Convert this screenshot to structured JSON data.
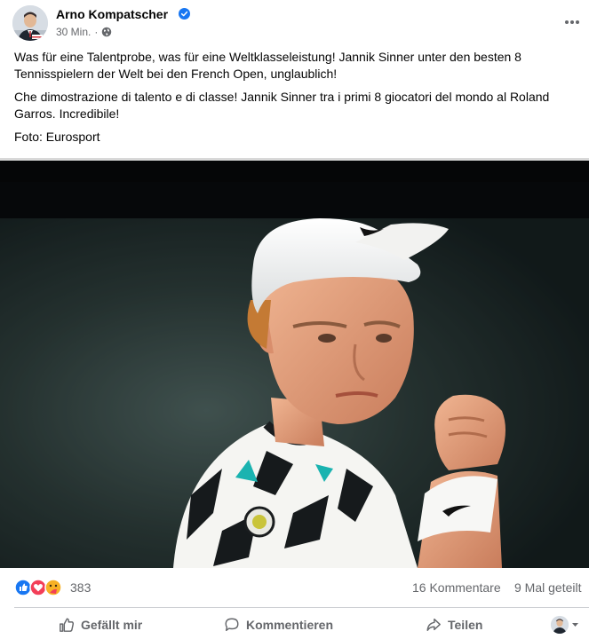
{
  "post": {
    "author": "Arno Kompatscher",
    "timestamp": "30 Min.",
    "separator": "·",
    "privacy_icon": "globe-icon",
    "verified_icon": "verified-badge-icon",
    "more_icon": "more-options-icon",
    "text_de": "Was für eine Talentprobe, was für eine Weltklasseleistung! Jannik Sinner unter den besten 8 Tennisspielern der Welt bei den French Open, unglaublich!",
    "text_it": "Che dimostrazione di talento e di classe! Jannik Sinner tra i primi 8 giocatori del mondo al Roland Garros. Incredibile!",
    "text_credit": "Foto: Eurosport"
  },
  "stats": {
    "reaction_icons": [
      "like-icon",
      "love-icon",
      "care-icon"
    ],
    "reaction_count": "383",
    "comments": "16 Kommentare",
    "shares": "9 Mal geteilt"
  },
  "actions": {
    "like_label": "Gefällt mir",
    "comment_label": "Kommentieren",
    "share_label": "Teilen"
  },
  "colors": {
    "facebook_blue": "#1877f2",
    "love_red": "#f33e58",
    "care_yellow": "#f7b125",
    "secondary_text": "#65676b"
  }
}
